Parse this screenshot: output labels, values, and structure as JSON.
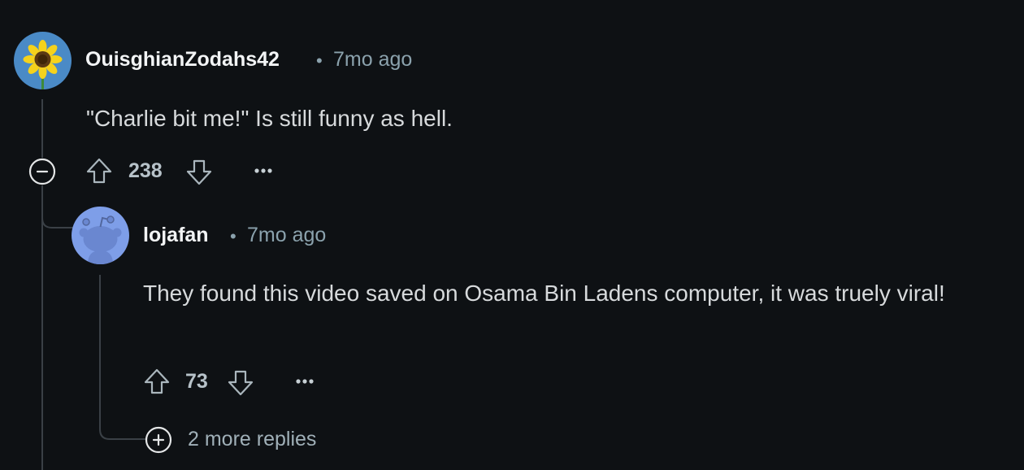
{
  "comments": [
    {
      "username": "OuisghianZodahs42",
      "separator": "•",
      "time": "7mo ago",
      "text": "\"Charlie bit me!\" Is still funny as hell.",
      "score": "238",
      "avatar_icon": "sunflower-avatar"
    },
    {
      "username": "lojafan",
      "separator": "•",
      "time": "7mo ago",
      "text": "They found this video saved on Osama Bin Ladens computer, it was truely viral!",
      "score": "73",
      "avatar_icon": "snoo-avatar"
    }
  ],
  "more_replies": {
    "label": "2 more replies"
  },
  "colors": {
    "background": "#0e1114",
    "thread_line": "#3a4046",
    "username": "#f2f4f5",
    "meta": "#8ba2ad",
    "body_text": "#d7dadc",
    "snoo_bg": "#7e9ee8"
  }
}
